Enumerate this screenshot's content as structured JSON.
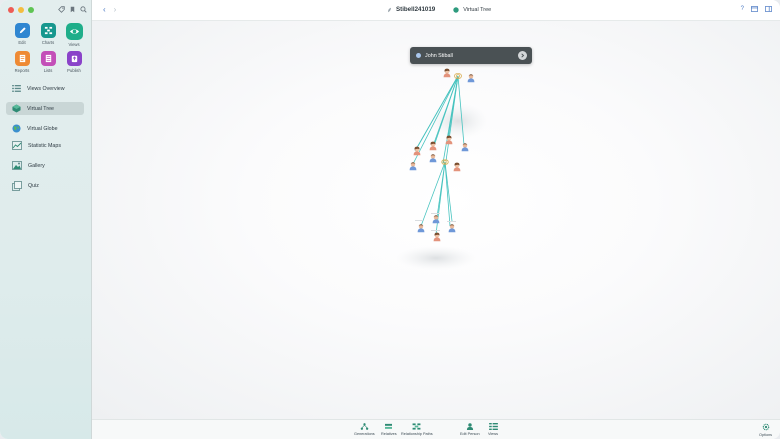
{
  "sidebar": {
    "grid": [
      {
        "label": "Edit",
        "icon": "pencil-icon"
      },
      {
        "label": "Charts",
        "icon": "charts-icon"
      },
      {
        "label": "Views",
        "icon": "eye-icon"
      },
      {
        "label": "Reports",
        "icon": "reports-icon"
      },
      {
        "label": "Lists",
        "icon": "lists-icon"
      },
      {
        "label": "Publish",
        "icon": "publish-icon"
      }
    ],
    "nav": [
      {
        "label": "Views Overview",
        "icon": "views-overview-icon"
      },
      {
        "label": "Virtual Tree",
        "icon": "virtual-tree-icon",
        "active": true
      },
      {
        "label": "Virtual Globe",
        "icon": "globe-icon"
      },
      {
        "label": "Statistic Maps",
        "icon": "statistic-maps-icon"
      },
      {
        "label": "Gallery",
        "icon": "gallery-icon"
      },
      {
        "label": "Quiz",
        "icon": "quiz-icon"
      }
    ]
  },
  "toolbar": {
    "file_name": "Stibell241019",
    "view_name": "Virtual Tree",
    "help": "?"
  },
  "canvas": {
    "popup_name": "John Stiball"
  },
  "bottombar": {
    "items": [
      {
        "label": "Generations",
        "icon": "generations-icon"
      },
      {
        "label": "Relatives",
        "icon": "relatives-icon"
      },
      {
        "label": "Relationship Paths",
        "icon": "relationship-paths-icon"
      },
      {
        "label": "Edit Person",
        "icon": "person-icon"
      },
      {
        "label": "Views",
        "icon": "views-icon"
      },
      {
        "label": "Options",
        "icon": "gear-icon"
      }
    ]
  },
  "colors": {
    "accent": "#4a79c4",
    "link_line": "#46c3bf",
    "sidebar_bg": "#e3eeee",
    "popup_bg": "#4a5154"
  }
}
